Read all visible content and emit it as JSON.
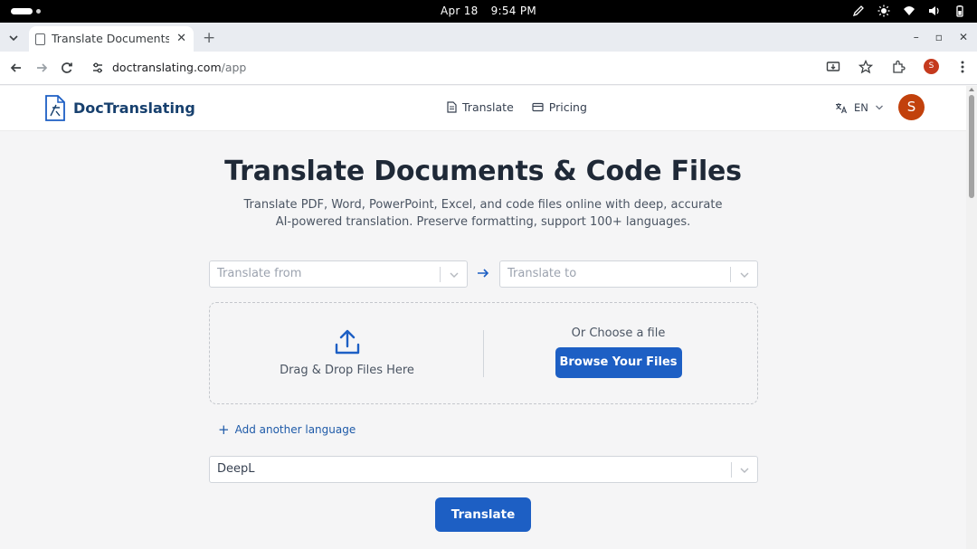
{
  "os": {
    "date": "Apr 18",
    "time": "9:54 PM"
  },
  "browser": {
    "tab_title": "Translate Documents & C",
    "tab_close": "✕",
    "new_tab": "+",
    "url_host": "doctranslating.com",
    "url_path": "/app",
    "profile_initial": "S",
    "window_controls": [
      "–",
      "▫",
      "✕"
    ]
  },
  "site": {
    "logo_text": "DocTranslating",
    "nav": [
      {
        "label": "Translate",
        "icon": "document-icon"
      },
      {
        "label": "Pricing",
        "icon": "card-icon"
      }
    ],
    "language": "EN",
    "avatar_initial": "S"
  },
  "main": {
    "title": "Translate Documents & Code Files",
    "subtitle": "Translate PDF, Word, PowerPoint, Excel, and code files online with deep, accurate AI-powered translation. Preserve formatting, support 100+ languages.",
    "from_placeholder": "Translate from",
    "to_placeholder": "Translate to",
    "drop_text": "Drag & Drop Files Here",
    "choose_text": "Or Choose a file",
    "browse_label": "Browse Your Files",
    "add_language": "Add another language",
    "engine": "DeepL",
    "translate_label": "Translate"
  },
  "colors": {
    "accent": "#1d5fc4",
    "avatar": "#c2410c",
    "logo": "#17406e"
  }
}
